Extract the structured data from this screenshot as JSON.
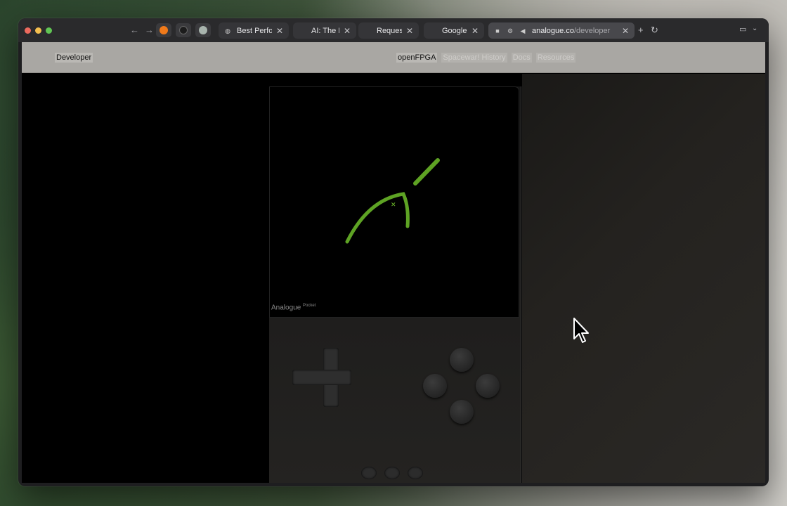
{
  "browser": {
    "tabs": [
      {
        "label": "Best Perfo"
      },
      {
        "label": "AI: The Ne"
      },
      {
        "label": "Request A"
      },
      {
        "label": "Google"
      }
    ],
    "active_tab": {
      "url_host": "analogue.co",
      "url_path": "/developer"
    }
  },
  "site": {
    "brand": "Developer",
    "nav": [
      "openFPGA",
      "Spacewar! History",
      "Docs",
      "Resources"
    ]
  },
  "device": {
    "brand": "Analogue",
    "model": "Pocket"
  },
  "colors": {
    "accent_green": "#6fbf2a"
  }
}
